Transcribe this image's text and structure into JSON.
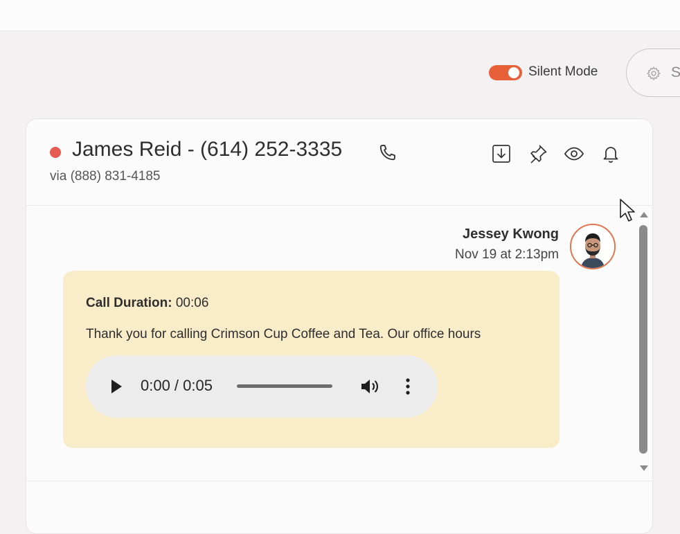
{
  "toolbar": {
    "silent_mode_label": "Silent Mode",
    "silent_mode_on": true,
    "settings_label": "S",
    "settings_icon": "gear-icon"
  },
  "conversation": {
    "contact_title": "James Reid - (614) 252-3335",
    "via_line": "via (888) 831-4185",
    "status": "unread",
    "icons": [
      "phone-icon",
      "download-icon",
      "pin-icon",
      "eye-icon",
      "bell-icon"
    ]
  },
  "message": {
    "sender": "Jessey Kwong",
    "timestamp": "Nov 19 at 2:13pm",
    "call_duration_label": "Call Duration:",
    "call_duration_value": "00:06",
    "transcript": "Thank you for calling Crimson Cup Coffee and Tea. Our office hours",
    "audio": {
      "time_display": "0:00 / 0:05",
      "progress": 0
    }
  },
  "colors": {
    "accent": "#e8603a",
    "status_dot": "#e65b4f",
    "bubble": "#f8ecc9"
  }
}
